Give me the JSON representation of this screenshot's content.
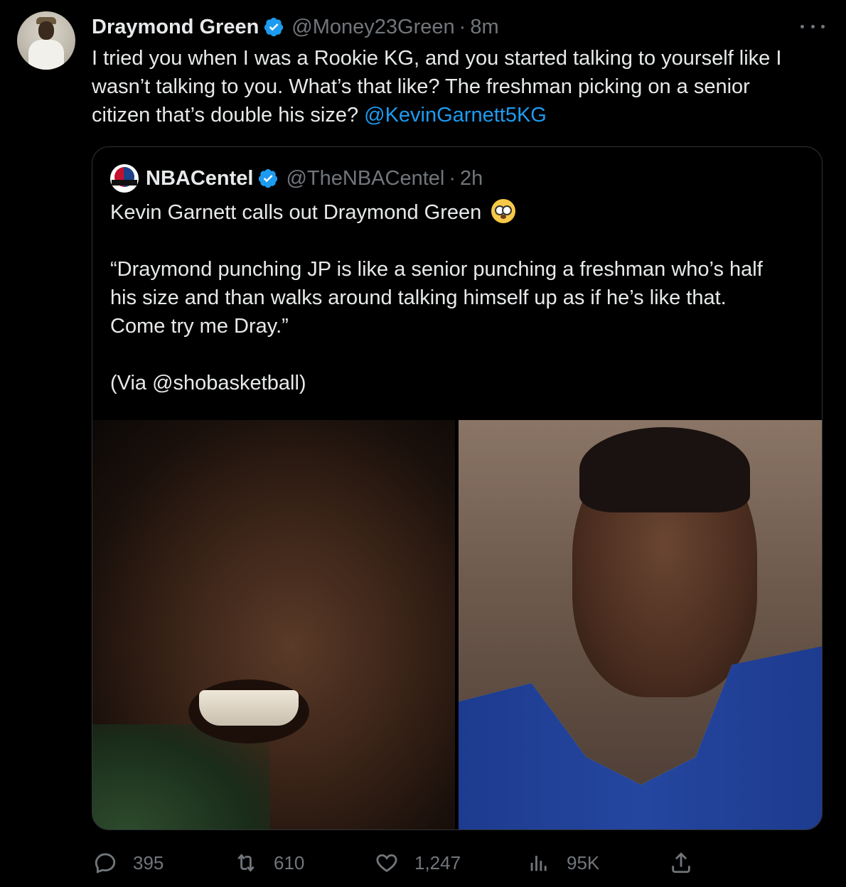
{
  "tweet": {
    "author_name": "Draymond Green",
    "author_handle": "@Money23Green",
    "separator": "·",
    "time": "8m",
    "text_lines": [
      "I tried you when I was a Rookie KG, and you started talking to yourself like I",
      "wasn’t talking to you.  What’s that like? The freshman picking on a senior",
      "citizen that’s double his size?"
    ],
    "mention": "@KevinGarnett5KG"
  },
  "quote": {
    "author_name": "NBACentel",
    "author_handle": "@TheNBACentel",
    "separator": "·",
    "time": "2h",
    "line1": "Kevin Garnett calls out Draymond Green",
    "emoji": "flushed-face",
    "quote_lines": [
      "“Draymond punching JP is like a senior punching a freshman who’s half",
      "his size and than walks around talking himself up as if he’s like that.",
      "Come try me Dray.”"
    ],
    "via": "(Via @shobasketball)"
  },
  "actions": {
    "replies": "395",
    "retweets": "610",
    "likes": "1,247",
    "views": "95K"
  },
  "colors": {
    "background": "#000000",
    "text": "#e7e9ea",
    "muted": "#71767b",
    "link": "#1d9bf0",
    "border": "#2f3336",
    "verified": "#1d9bf0"
  }
}
